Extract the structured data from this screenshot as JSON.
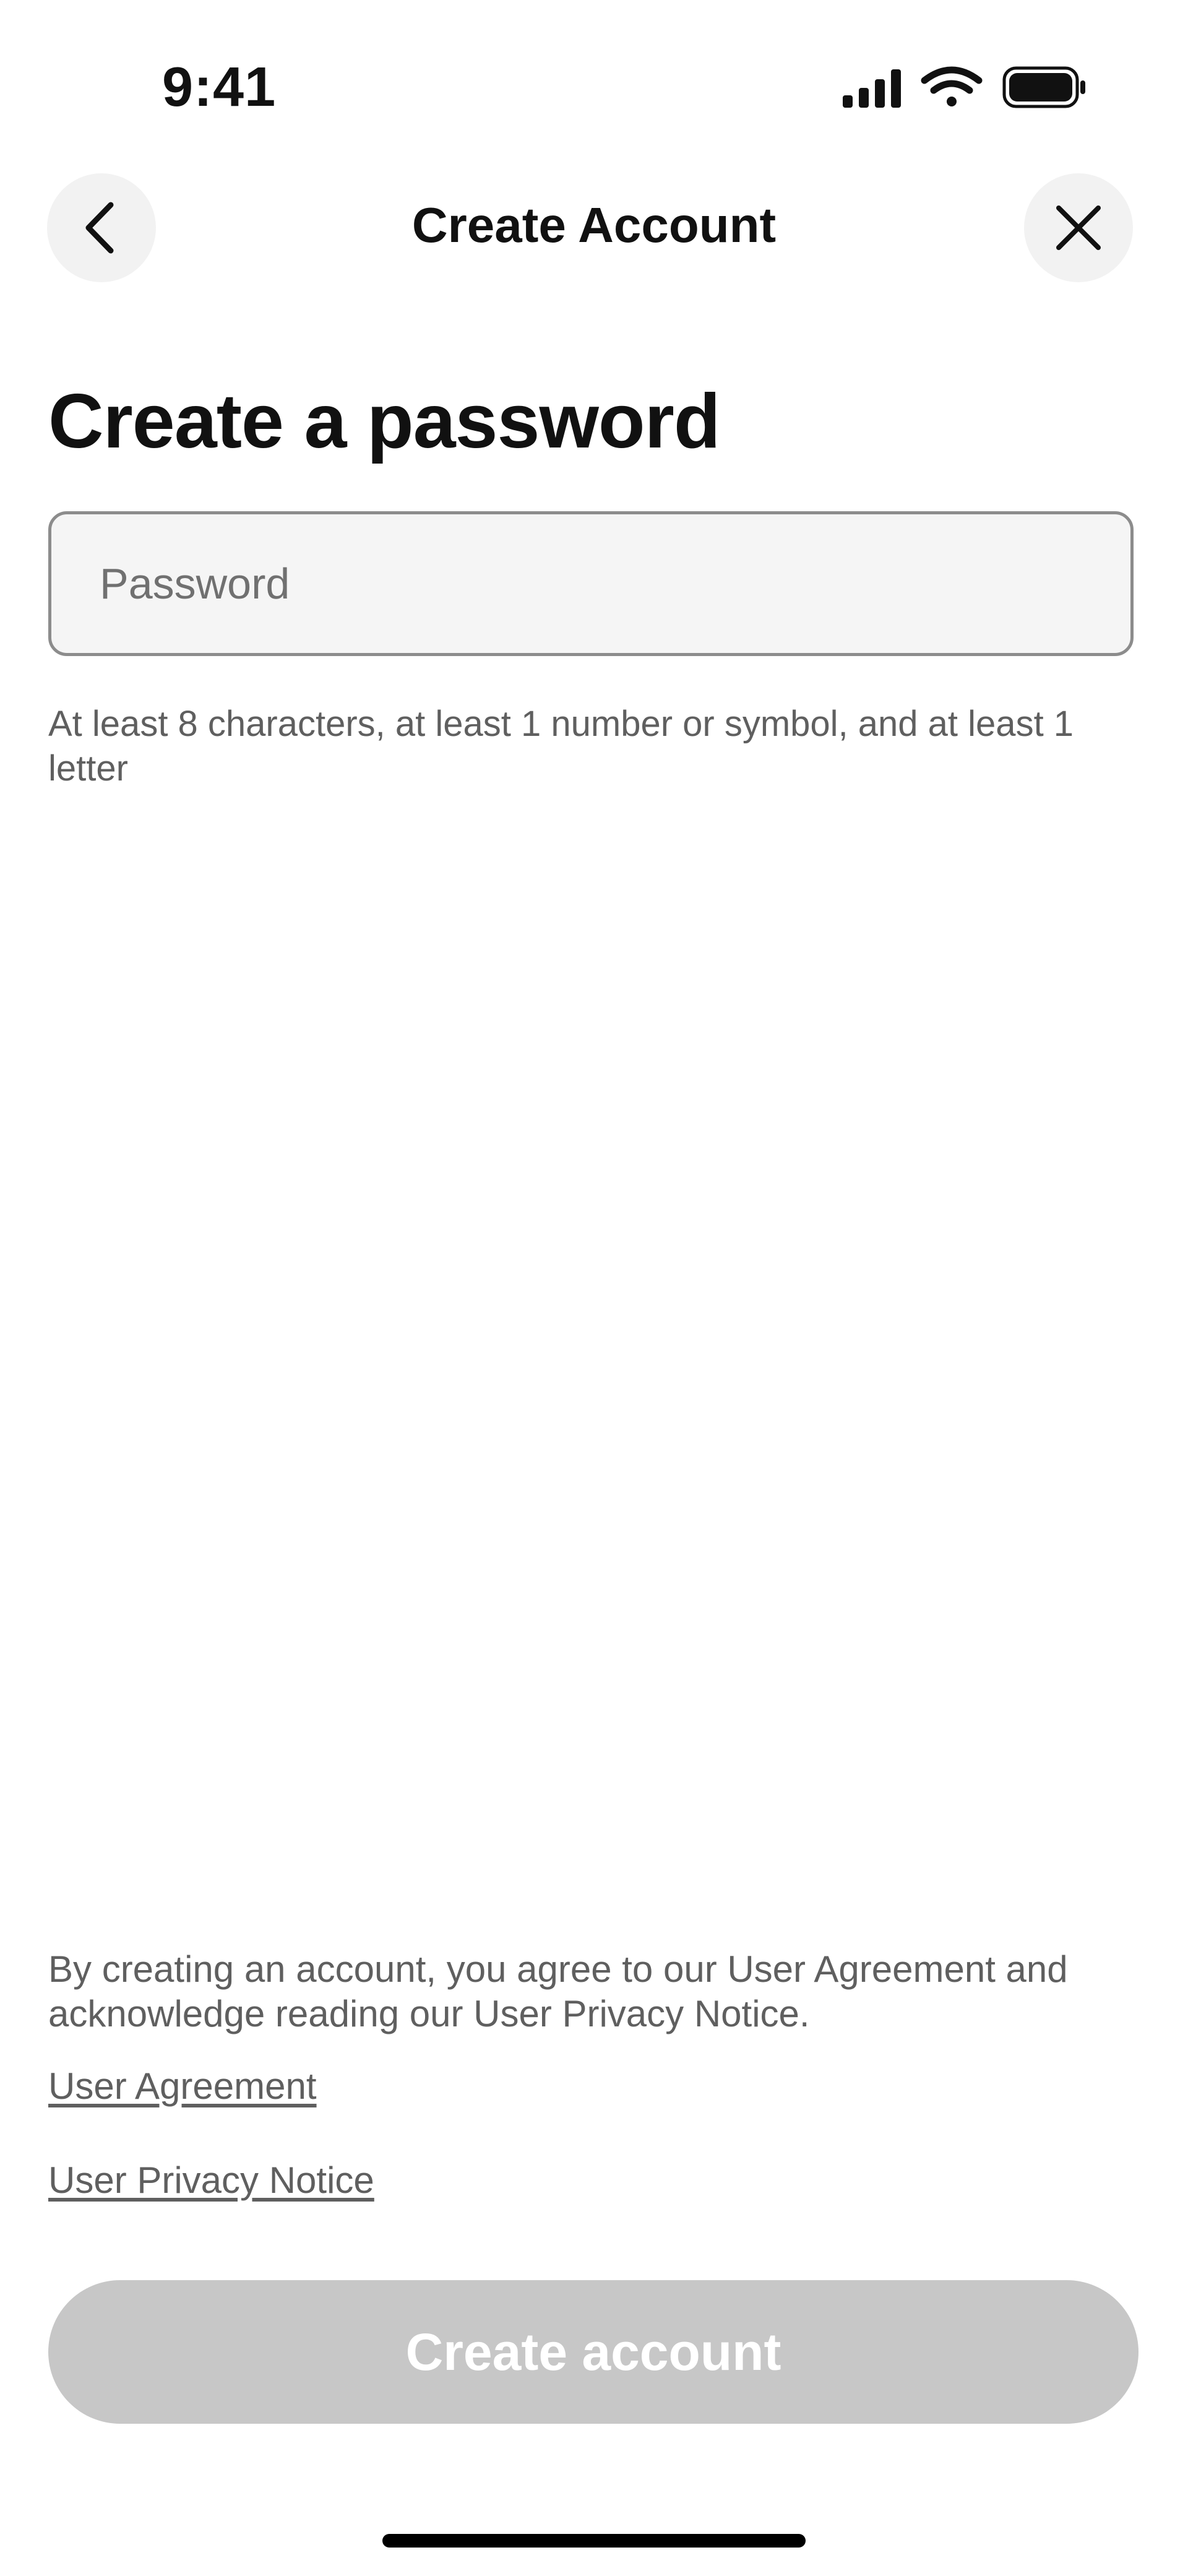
{
  "status_bar": {
    "time": "9:41",
    "icons": [
      "cellular-signal-icon",
      "wifi-icon",
      "battery-icon"
    ]
  },
  "header": {
    "title": "Create Account",
    "back_icon": "chevron-left-icon",
    "close_icon": "close-icon"
  },
  "main": {
    "heading": "Create a password",
    "password": {
      "placeholder": "Password",
      "value": ""
    },
    "hint": "At least 8 characters, at least 1 number or symbol, and at least 1 letter"
  },
  "legal": {
    "text": "By creating an account, you agree to our User Agreement and acknowledge reading our User Privacy Notice.",
    "links": {
      "agreement": "User Agreement",
      "privacy": "User Privacy Notice"
    }
  },
  "actions": {
    "create_label": "Create account",
    "enabled": false
  },
  "colors": {
    "button_disabled": "#c7c7c7",
    "secondary_text": "#5f5f5f",
    "input_border": "#8c8c8c",
    "input_background": "#f5f5f5"
  }
}
